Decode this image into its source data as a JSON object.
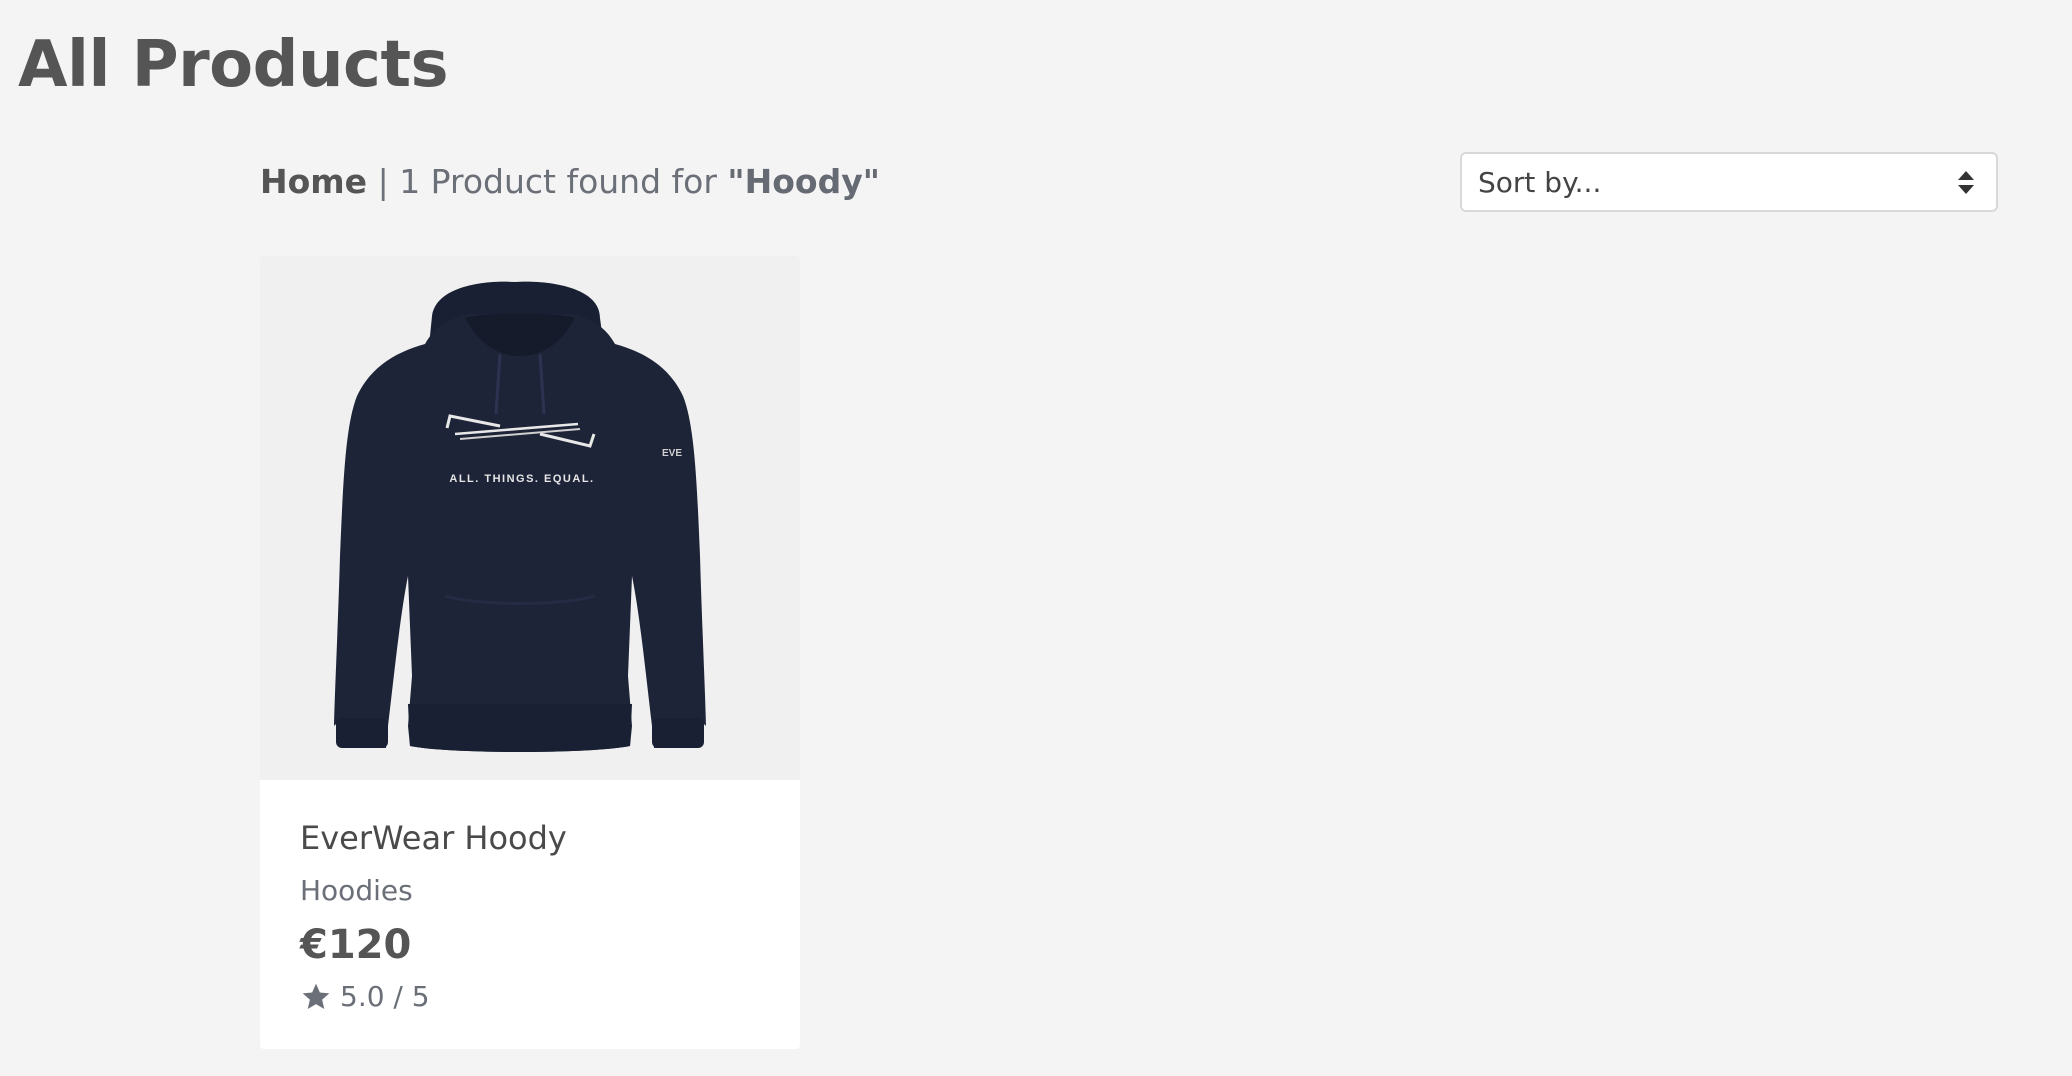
{
  "page": {
    "title": "All Products"
  },
  "breadcrumb": {
    "home": "Home",
    "separator": "|",
    "result_text": "1 Product found for",
    "query": "\"Hoody\""
  },
  "sort": {
    "label": "Sort by...",
    "icon": "sort-arrows-icon"
  },
  "products": [
    {
      "name": "EverWear Hoody",
      "category": "Hoodies",
      "price": "€120",
      "rating": "5.0 / 5",
      "rating_icon": "star-icon",
      "image_print_text": "ALL. THINGS. EQUAL.",
      "image_sleeve_text": "EVE",
      "image_color": "#1e2438"
    }
  ],
  "colors": {
    "background": "#f4f4f4",
    "card": "#ffffff",
    "text": "#555555",
    "muted": "#6b6f78"
  }
}
